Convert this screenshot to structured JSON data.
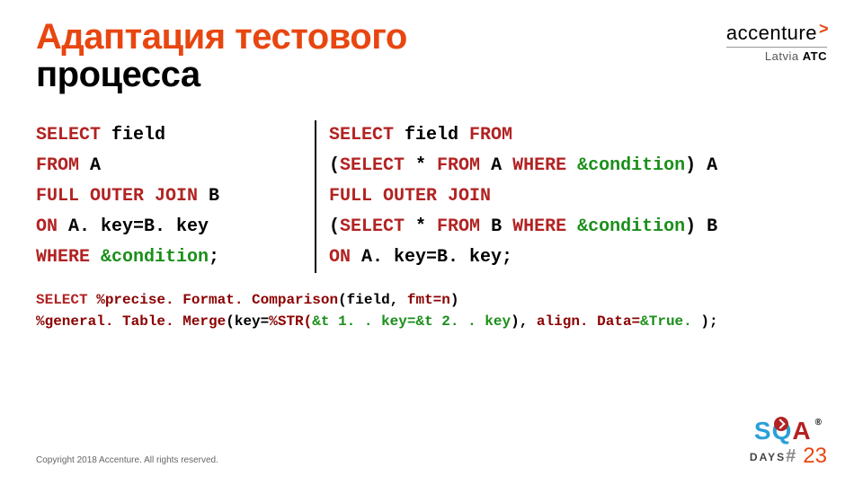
{
  "title": {
    "line1": "Адаптация тестового",
    "line2": "процесса"
  },
  "logo": {
    "brand": "accenture",
    "sub1": "Latvia",
    "sub2": "ATC"
  },
  "code_left": {
    "l1a": "SELECT",
    "l1b": " field",
    "l2a": "FROM",
    "l2b": " A",
    "l3a": "FULL OUTER JOIN",
    "l3b": " B",
    "l4a": "ON",
    "l4b": " A. key=B. key",
    "l5a": "WHERE",
    "l5b": " &condition",
    "l5c": ";"
  },
  "code_right": {
    "l1a": "SELECT",
    "l1b": " field ",
    "l1c": "FROM",
    "l2a": "(",
    "l2b": "SELECT",
    "l2c": " * ",
    "l2d": "FROM",
    "l2e": " A ",
    "l2f": "WHERE",
    "l2g": " &condition",
    "l2h": ") A",
    "l3a": "FULL OUTER JOIN",
    "l4a": "(",
    "l4b": "SELECT",
    "l4c": " * ",
    "l4d": "FROM",
    "l4e": " B ",
    "l4f": "WHERE",
    "l4g": " &condition",
    "l4h": ") B",
    "l5a": "ON",
    "l5b": " A. key=B. key;"
  },
  "code_bottom": {
    "l1a": "SELECT ",
    "l1b": "%precise. Format. Comparison",
    "l1c": "(field, ",
    "l1d": "fmt=n",
    "l1e": ")",
    "l2a": "%general. Table. Merge",
    "l2b": "(key=",
    "l2c": "%STR(",
    "l2d": "&t 1. . key=&t 2. . key",
    "l2e": "), ",
    "l2f": "align. Data=",
    "l2g": "&True. ",
    "l2h": ");"
  },
  "footer": "Copyright 2018 Accenture. All rights reserved.",
  "sqa": {
    "s": "S",
    "q": "Q",
    "a": "A",
    "reg": "®",
    "days": "DAYS",
    "hash": "#",
    "num": "23"
  }
}
